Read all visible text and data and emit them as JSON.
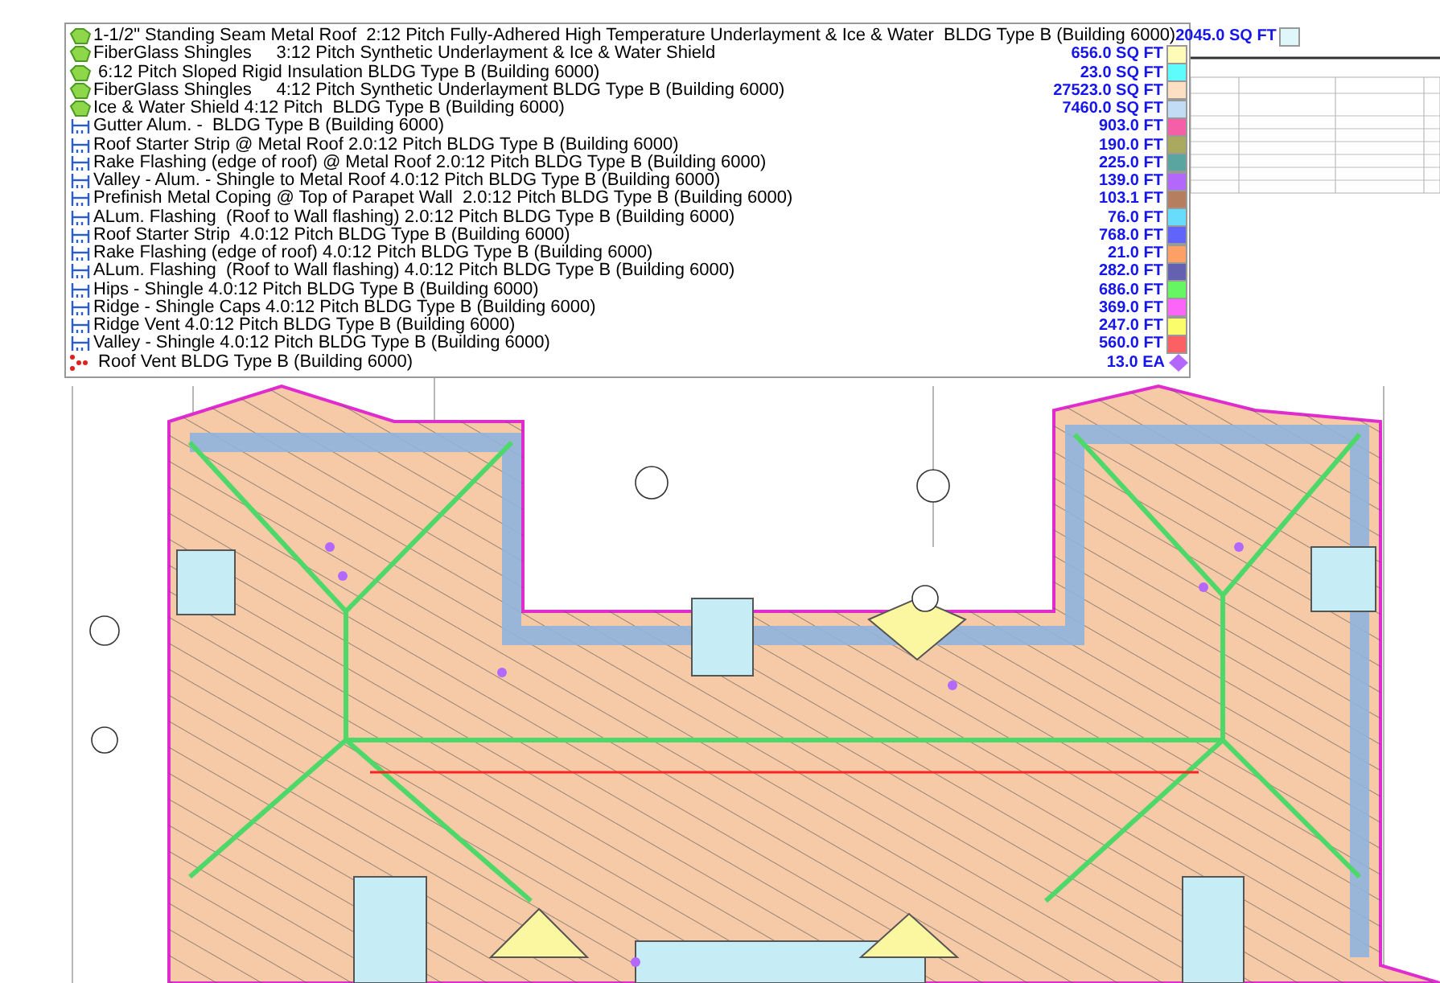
{
  "legend": {
    "items": [
      {
        "kind": "area",
        "label": "1-1/2\" Standing Seam Metal Roof  2:12 Pitch Fully-Adhered High Temperature Underlayment & Ice & Water  BLDG Type B (Building 6000)",
        "quantity": "2045.0 SQ FT",
        "color": "#dff6fa"
      },
      {
        "kind": "area",
        "label": "FiberGlass Shingles     3:12 Pitch Synthetic Underlayment & Ice & Water Shield",
        "quantity": "656.0 SQ FT",
        "color": "#fffcb8"
      },
      {
        "kind": "area",
        "label": " 6:12 Pitch Sloped Rigid Insulation BLDG Type B (Building 6000)",
        "quantity": "23.0 SQ FT",
        "color": "#5ffcfd"
      },
      {
        "kind": "area",
        "label": "FiberGlass Shingles     4:12 Pitch Synthetic Underlayment BLDG Type B (Building 6000)",
        "quantity": "27523.0 SQ FT",
        "color": "#fde0c4"
      },
      {
        "kind": "area",
        "label": "Ice & Water Shield 4:12 Pitch  BLDG Type B (Building 6000)",
        "quantity": "7460.0 SQ FT",
        "color": "#c2dcf5"
      },
      {
        "kind": "length",
        "label": "Gutter Alum. -  BLDG Type B (Building 6000)",
        "quantity": "903.0 FT",
        "color": "#f55fa8"
      },
      {
        "kind": "length",
        "label": "Roof Starter Strip @ Metal Roof 2.0:12 Pitch BLDG Type B (Building 6000)",
        "quantity": "190.0 FT",
        "color": "#aaa960"
      },
      {
        "kind": "length",
        "label": "Rake Flashing (edge of roof) @ Metal Roof 2.0:12 Pitch BLDG Type B (Building 6000)",
        "quantity": "225.0 FT",
        "color": "#5aa5a0"
      },
      {
        "kind": "length",
        "label": "Valley - Alum. - Shingle to Metal Roof 4.0:12 Pitch BLDG Type B (Building 6000)",
        "quantity": "139.0 FT",
        "color": "#b368fb"
      },
      {
        "kind": "length",
        "label": "Prefinish Metal Coping @ Top of Parapet Wall  2.0:12 Pitch BLDG Type B (Building 6000)",
        "quantity": "103.1 FT",
        "color": "#b57f5f"
      },
      {
        "kind": "length",
        "label": "ALum. Flashing  (Roof to Wall flashing) 2.0:12 Pitch BLDG Type B (Building 6000)",
        "quantity": "76.0 FT",
        "color": "#68dcfb"
      },
      {
        "kind": "length",
        "label": "Roof Starter Strip  4.0:12 Pitch BLDG Type B (Building 6000)",
        "quantity": "768.0 FT",
        "color": "#6064fb"
      },
      {
        "kind": "length",
        "label": "Rake Flashing (edge of roof) 4.0:12 Pitch BLDG Type B (Building 6000)",
        "quantity": "21.0 FT",
        "color": "#fda066"
      },
      {
        "kind": "length",
        "label": "ALum. Flashing  (Roof to Wall flashing) 4.0:12 Pitch BLDG Type B (Building 6000)",
        "quantity": "282.0 FT",
        "color": "#6461b0"
      },
      {
        "kind": "length",
        "label": "Hips - Shingle 4.0:12 Pitch BLDG Type B (Building 6000)",
        "quantity": "686.0 FT",
        "color": "#66f563"
      },
      {
        "kind": "length",
        "label": "Ridge - Shingle Caps 4.0:12 Pitch BLDG Type B (Building 6000)",
        "quantity": "369.0 FT",
        "color": "#fb66f8"
      },
      {
        "kind": "length",
        "label": "Ridge Vent 4.0:12 Pitch BLDG Type B (Building 6000)",
        "quantity": "247.0 FT",
        "color": "#fbfd6a"
      },
      {
        "kind": "length",
        "label": "Valley - Shingle 4.0:12 Pitch BLDG Type B (Building 6000)",
        "quantity": "560.0 FT",
        "color": "#fb6063"
      },
      {
        "kind": "count",
        "label": " Roof Vent BLDG Type B (Building 6000)",
        "quantity": "13.0 EA",
        "color": "#b368fb"
      }
    ]
  }
}
